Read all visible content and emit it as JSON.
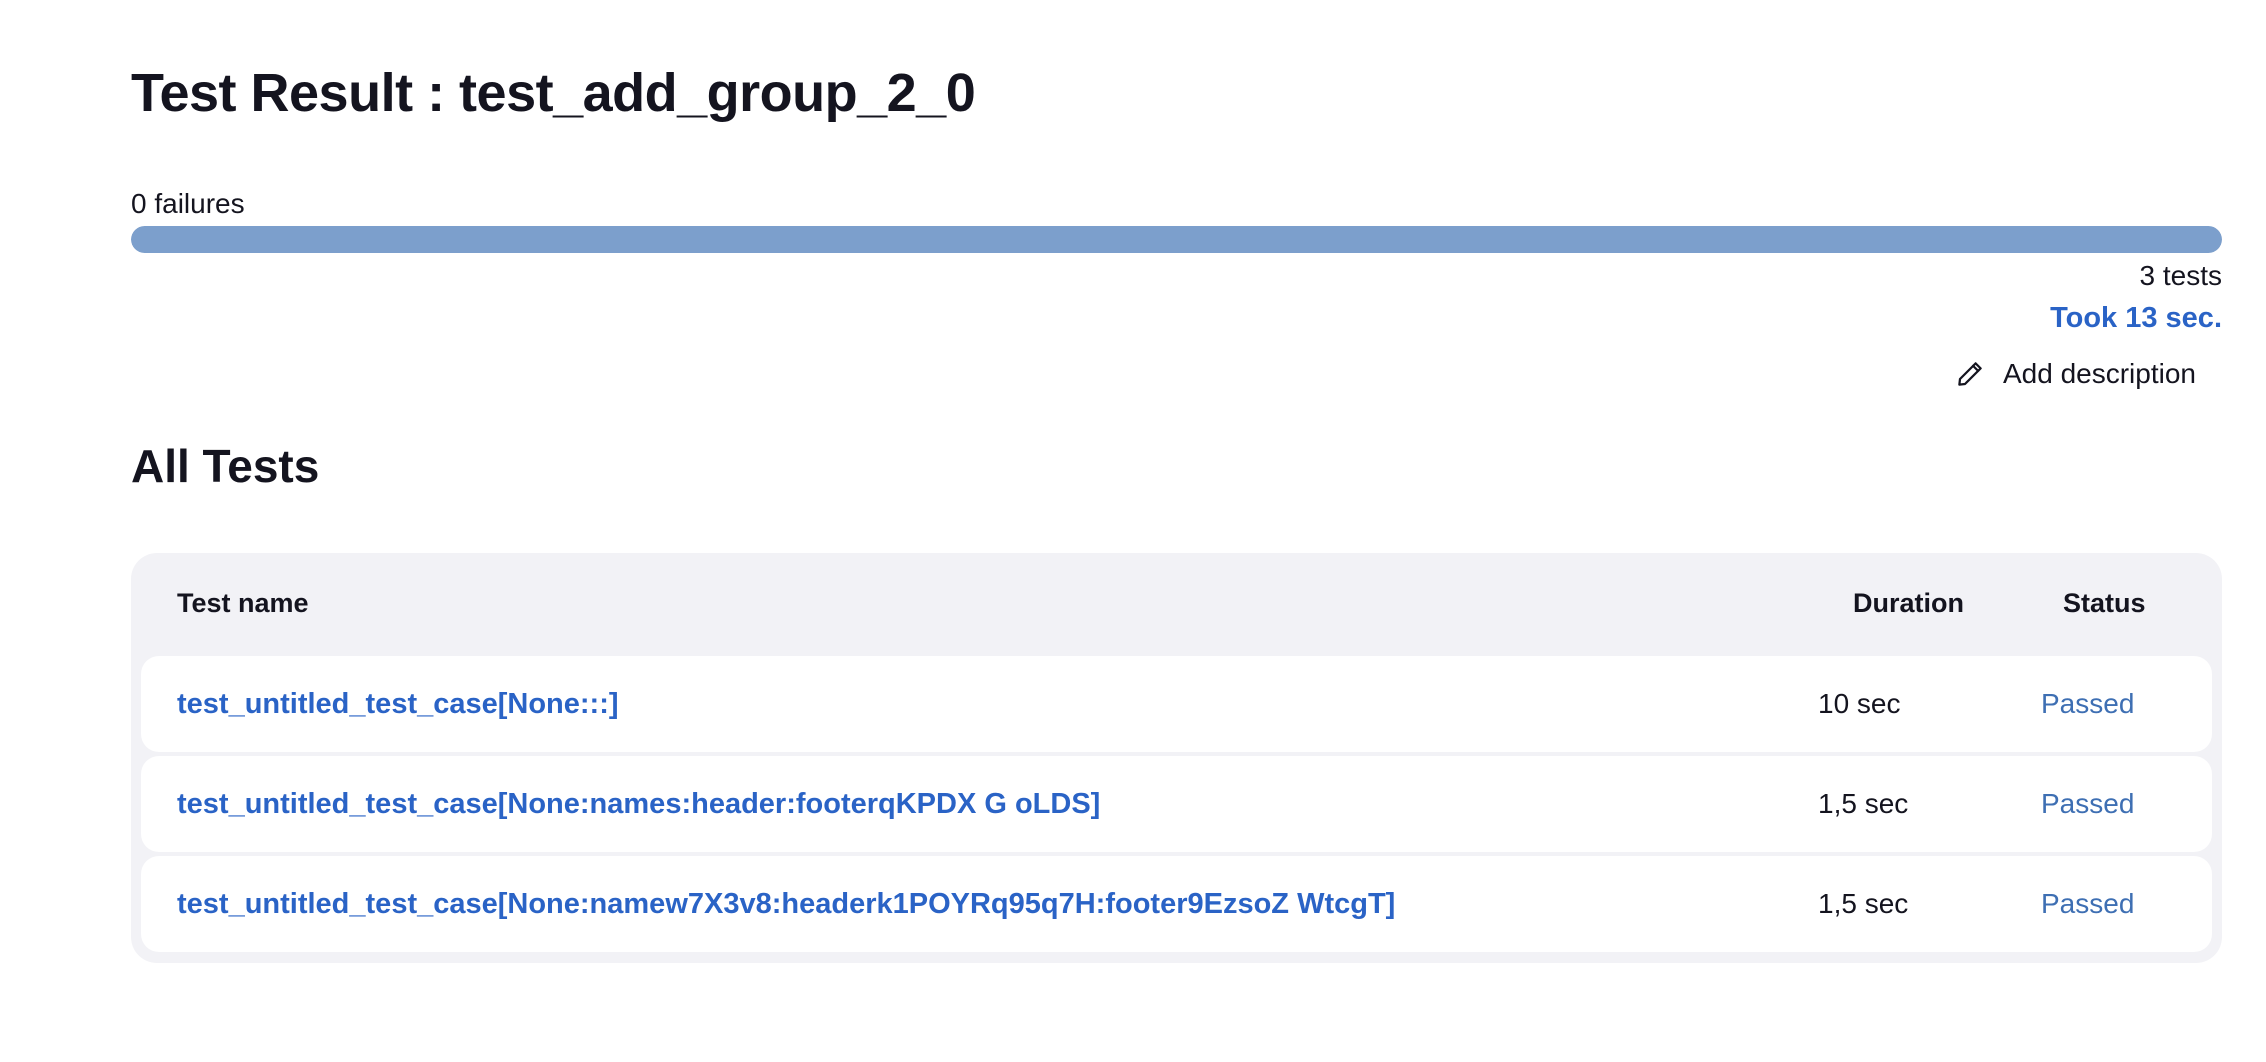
{
  "page": {
    "title": "Test Result : test_add_group_2_0"
  },
  "summary": {
    "failures_text": "0 failures",
    "progress_pass_fraction": 1.0,
    "tests_text": "3 tests",
    "took_text": "Took 13 sec.",
    "add_description_label": "Add description",
    "add_description_icon": "pencil-icon"
  },
  "all_tests": {
    "heading": "All Tests",
    "columns": {
      "name": "Test name",
      "duration": "Duration",
      "status": "Status"
    },
    "rows": [
      {
        "name": "test_untitled_test_case[None:::]",
        "duration": "10 sec",
        "status": "Passed"
      },
      {
        "name": "test_untitled_test_case[None:names:header:footerqKPDX G oLDS]",
        "duration": "1,5 sec",
        "status": "Passed"
      },
      {
        "name": "test_untitled_test_case[None:namew7X3v8:headerk1POYRq95q7H:footer9EzsoZ WtcgT]",
        "duration": "1,5 sec",
        "status": "Passed"
      }
    ]
  },
  "colors": {
    "accent_link": "#2a63c6",
    "progress_pass": "#7c9fcc",
    "status_passed": "#3e6fb3",
    "table_background": "#f2f2f6"
  }
}
